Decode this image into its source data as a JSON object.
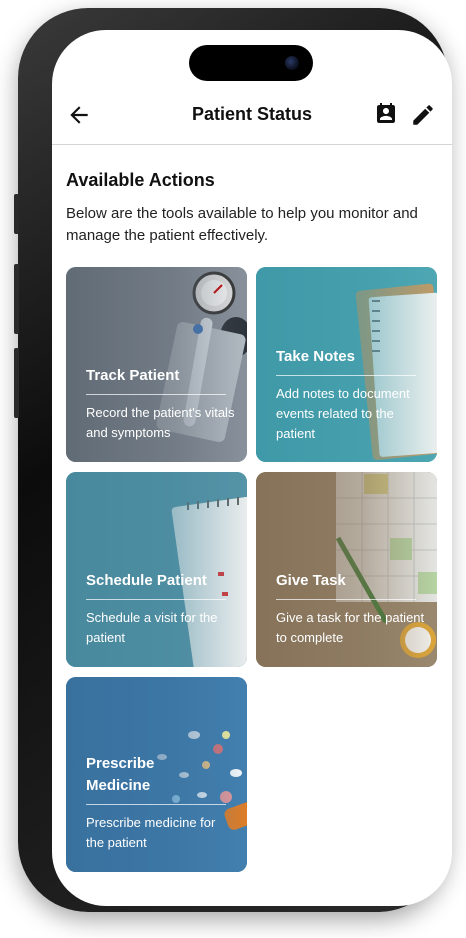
{
  "header": {
    "title": "Patient Status",
    "back_icon": "arrow-left-icon",
    "actions": [
      "contact-card-icon",
      "pencil-edit-icon"
    ]
  },
  "section": {
    "title": "Available Actions",
    "description": "Below are the tools available to help you monitor and manage the patient effectively."
  },
  "cards": [
    {
      "title": "Track Patient",
      "description": "Record the patient's vitals and symptoms",
      "image": "blood-pressure-gauge-thermometer",
      "tint": "#7f8a96"
    },
    {
      "title": "Take Notes",
      "description": "Add notes to document events related to the patient",
      "image": "notebook-on-teal",
      "tint": "#4aa3b0"
    },
    {
      "title": "Schedule Patient",
      "description": "Schedule a visit for the patient",
      "image": "calendar-on-teal",
      "tint": "#4f8ea3"
    },
    {
      "title": "Give Task",
      "description": "Give a task for the patient to complete",
      "image": "calendar-pen-alarm-clock",
      "tint": "#8f7b62"
    },
    {
      "title": "Prescribe Medicine",
      "description": "Prescribe medicine for the patient",
      "image": "pills-on-blue",
      "tint": "#3e76a6"
    }
  ]
}
